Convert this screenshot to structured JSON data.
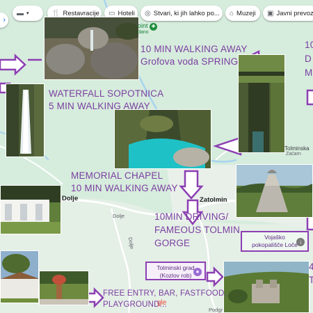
{
  "chips": {
    "restaurants": "Restavracije",
    "hotels": "Hoteli",
    "things_to_do": "Stvari, ki jih lahko po...",
    "museums": "Muzeji",
    "transit": "Javni prevoz"
  },
  "notes": {
    "spring_line1": "10 MIN WALKING AWAY",
    "spring_line2": "Grofova voda SPRING",
    "waterfall_line1": "WATERFALL SOPOTNICA",
    "waterfall_line2": "5 MIN WALKING AWAY",
    "chapel_line1": "MEMORIAL CHAPEL",
    "chapel_line2": "10 MIN WALKING AWAY",
    "gorge_line1": "10MIN DRIVING/",
    "gorge_line2": "FAMEOUS TOLMIN",
    "gorge_line3": "GORGE",
    "free_line1": "FREE ENTRY, BAR, FASTFOOD,",
    "free_line2": "PLAYGROUND...",
    "right_top_1": "10",
    "right_top_2": "D",
    "right_top_3": "M",
    "right_bottom_1": "4",
    "right_bottom_2": "T"
  },
  "places": {
    "dolje1": "Dolje",
    "dolje2": "Dolje",
    "zatolmin": "Zatolmin",
    "tolminska": "Tolminska",
    "tolminska2": "Zaćarn",
    "road_dolje": "Dolje",
    "point_label": "oint",
    "point_label2": "dano",
    "podgr": "Podgr"
  },
  "boxes": {
    "vojasko_line1": "Vojaško",
    "vojasko_line2": "pokopališče Loče",
    "grad_line1": "Tolminski grad",
    "grad_line2": "(Kozlov rob)"
  },
  "google": "gle",
  "colors": {
    "annotation": "#7b3fa0",
    "map_bg": "#d8eddf",
    "arrow": "#8c3fb3"
  }
}
